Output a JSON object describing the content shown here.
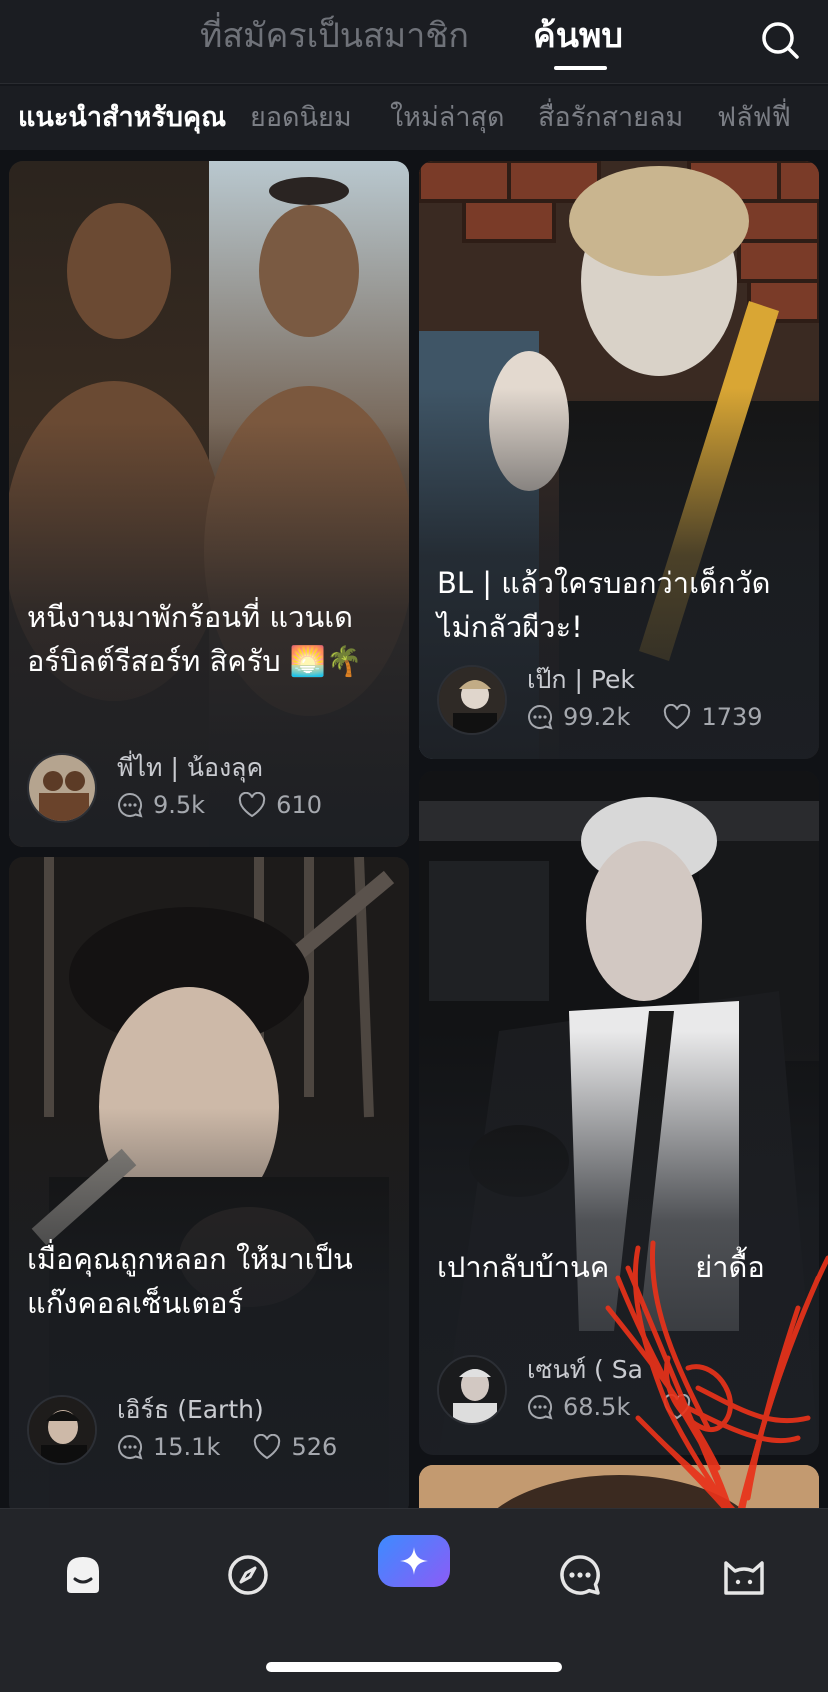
{
  "header": {
    "tabs": [
      {
        "label": "ที่สมัครเป็นสมาชิก",
        "active": false
      },
      {
        "label": "ค้นพบ",
        "active": true
      }
    ],
    "search_icon": "search-icon"
  },
  "categories": [
    {
      "label": "แนะนำสำหรับคุณ",
      "active": true
    },
    {
      "label": "ยอดนิยม",
      "active": false
    },
    {
      "label": "ใหม่ล่าสุด",
      "active": false
    },
    {
      "label": "สื่อรักสายลม",
      "active": false
    },
    {
      "label": "ฟลัฟฟี่",
      "active": false
    }
  ],
  "cards": [
    {
      "title_line1": "หนีงานมาพักร้อนที่ แวนเด",
      "title_line2": "อร์บิลต์รีสอร์ท สิครับ 🌅🌴",
      "author": "พี่ไท | น้องลุค",
      "comments": "9.5k",
      "likes": "610"
    },
    {
      "title_line1": "BL | แล้วใครบอกว่าเด็กวัด",
      "title_line2": "ไม่กลัวผีวะ!",
      "author": "เป๊ก | Pek",
      "comments": "99.2k",
      "likes": "1739"
    },
    {
      "title_line1": "เมื่อคุณถูกหลอก ให้มาเป็น",
      "title_line2": "แก๊งคอลเซ็นเตอร์",
      "author": "เอิร์ธ (Earth)",
      "comments": "15.1k",
      "likes": "526"
    },
    {
      "title_line1": "เปากลับบ้านค",
      "title_line2": "ย่าดื้อ",
      "author": "เซนท์ ( Sa",
      "comments": "68.5k",
      "likes": ""
    }
  ],
  "nav": [
    {
      "name": "home-icon",
      "active": true
    },
    {
      "name": "compass-icon",
      "active": false
    },
    {
      "name": "create-sparkle-icon",
      "active": false
    },
    {
      "name": "chat-icon",
      "active": false
    },
    {
      "name": "profile-cat-icon",
      "active": false
    }
  ],
  "colors": {
    "background": "#15171c",
    "card": "#1c1f24",
    "accent_gradient_start": "#3d8bff",
    "accent_gradient_end": "#8b5cf6",
    "annotation_red": "#e8321a"
  }
}
